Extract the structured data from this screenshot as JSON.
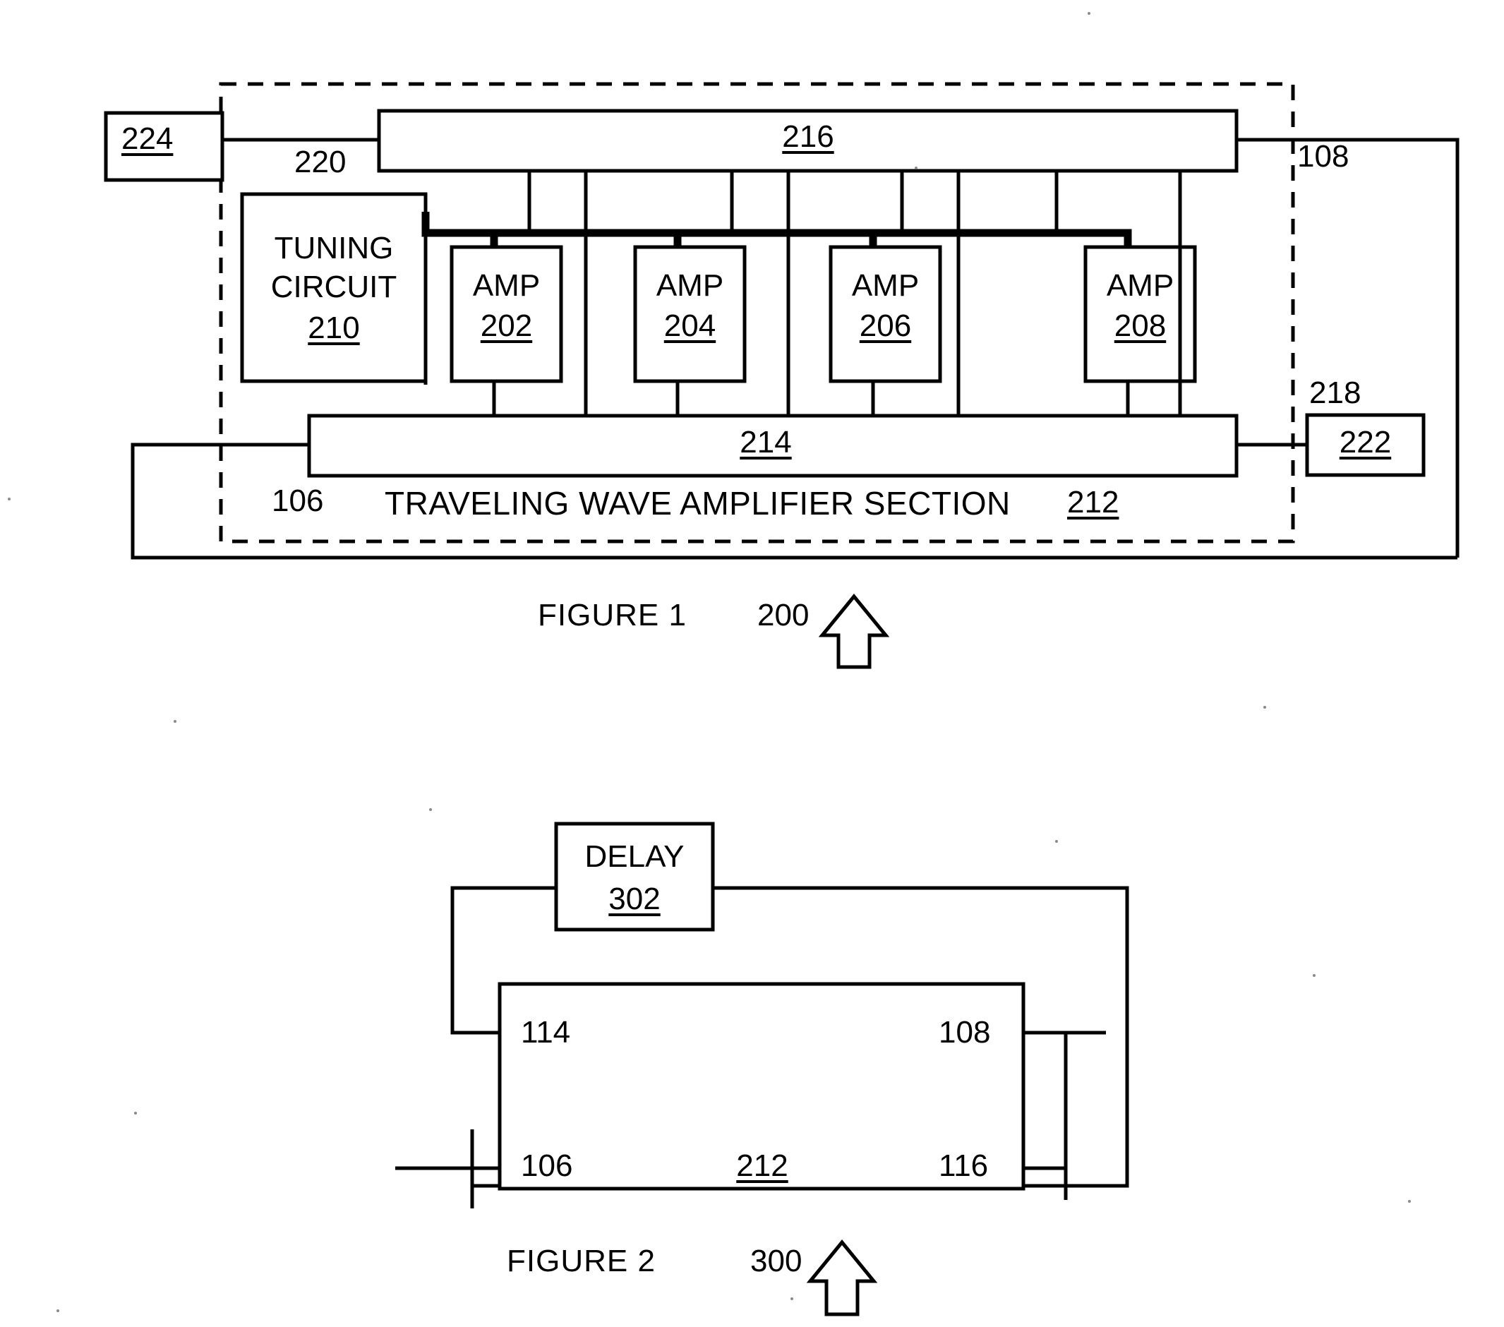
{
  "document": {
    "type": "patent-drawing-sheet",
    "figures": [
      {
        "id": "figure-1",
        "caption": "FIGURE 1",
        "ref": "200",
        "arrow": "up-arrow-icon",
        "section_label": "TRAVELING  WAVE AMPLIFIER SECTION",
        "section_ref": "212",
        "enclosure_ref": "106",
        "blocks": [
          {
            "name": "port-224",
            "label": "",
            "ref": "224",
            "ref_underlined": true
          },
          {
            "name": "output-line-216",
            "label": "",
            "ref": "216",
            "ref_underlined": true
          },
          {
            "name": "tuning-circuit",
            "label_line1": "TUNING",
            "label_line2": "CIRCUIT",
            "ref": "210",
            "ref_underlined": true
          },
          {
            "name": "amp-202",
            "label": "AMP",
            "ref": "202",
            "ref_underlined": true
          },
          {
            "name": "amp-204",
            "label": "AMP",
            "ref": "204",
            "ref_underlined": true
          },
          {
            "name": "amp-206",
            "label": "AMP",
            "ref": "206",
            "ref_underlined": true
          },
          {
            "name": "amp-208",
            "label": "AMP",
            "ref": "208",
            "ref_underlined": true
          },
          {
            "name": "input-line-214",
            "label": "",
            "ref": "214",
            "ref_underlined": true
          },
          {
            "name": "port-222",
            "label": "",
            "ref": "222",
            "ref_underlined": true
          }
        ],
        "lead_refs": [
          {
            "name": "lead-220",
            "ref": "220"
          },
          {
            "name": "lead-108",
            "ref": "108"
          },
          {
            "name": "lead-218",
            "ref": "218"
          },
          {
            "name": "lead-106",
            "ref": "106"
          }
        ]
      },
      {
        "id": "figure-2",
        "caption": "FIGURE 2",
        "ref": "300",
        "arrow": "up-arrow-icon",
        "blocks": [
          {
            "name": "delay-block",
            "label": "DELAY",
            "ref": "302",
            "ref_underlined": true
          },
          {
            "name": "twa-section-block",
            "label": "",
            "ref": "212",
            "ref_underlined": true
          }
        ],
        "port_refs": [
          {
            "name": "port-114",
            "ref": "114"
          },
          {
            "name": "port-108",
            "ref": "108"
          },
          {
            "name": "port-106",
            "ref": "106"
          },
          {
            "name": "port-116",
            "ref": "116"
          }
        ]
      }
    ],
    "colors": {
      "ink": "#000000",
      "paper": "#ffffff"
    }
  }
}
